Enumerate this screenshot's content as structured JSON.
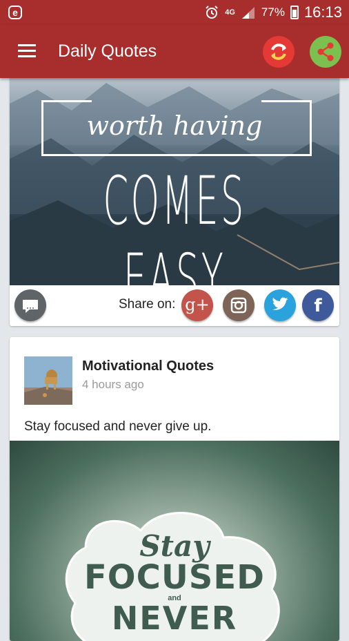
{
  "status_bar": {
    "network": "4G",
    "battery": "77%",
    "time": "16:13"
  },
  "app_bar": {
    "title": "Daily Quotes"
  },
  "colors": {
    "primary": "#a82d2d",
    "refresh": "#e53935",
    "share": "#7cc04f",
    "google": "#c2544b",
    "instagram": "#7d6457",
    "twitter": "#2aa3dc",
    "facebook": "#3f5a9a"
  },
  "card1": {
    "quote_line1": "worth having",
    "quote_line2": "COMES EASY",
    "share_label": "Share on:",
    "google_glyph": "g+",
    "facebook_glyph": "f"
  },
  "card2": {
    "author": "Motivational Quotes",
    "time": "4 hours ago",
    "text": "Stay focused and never give up.",
    "quote_stay": "Stay",
    "quote_focused": "FOCUSED",
    "quote_and": "and",
    "quote_never": "NEVER"
  }
}
